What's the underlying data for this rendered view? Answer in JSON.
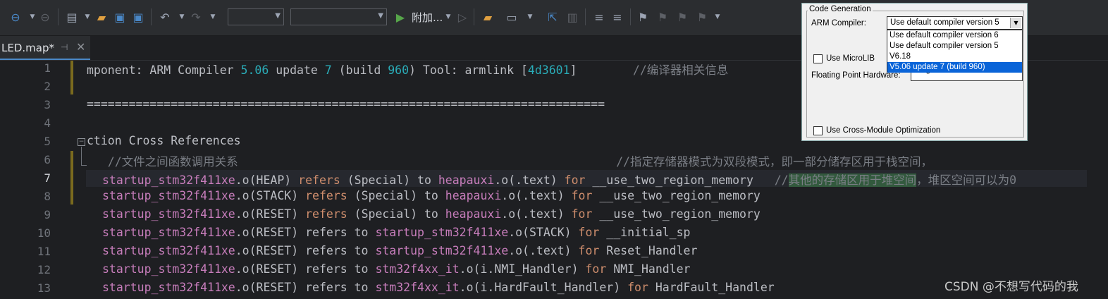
{
  "toolbar": {
    "run_label": "附加...",
    "combo1_value": "",
    "combo2_value": ""
  },
  "tab": {
    "label": "LED.map*"
  },
  "editor": {
    "line_numbers": [
      "1",
      "2",
      "3",
      "4",
      "5",
      "6",
      "7",
      "8",
      "9",
      "10",
      "11",
      "12",
      "13"
    ],
    "active_line": "7"
  },
  "dialog": {
    "group_title": "Code Generation",
    "arm_compiler_label": "ARM Compiler:",
    "arm_compiler_selected": "Use default compiler version 5",
    "options": [
      "Use default compiler version 6",
      "Use default compiler version 5",
      "V6.18",
      "V5.06 update 7 (build 960)"
    ],
    "use_microlib_label": "Use MicroLIB",
    "floating_point_label": "Floating Point Hardware:",
    "floating_point_value": "Single Precision",
    "cross_module_label": "Use Cross-Module Optimization"
  },
  "watermark": "CSDN @不想写代码的我"
}
